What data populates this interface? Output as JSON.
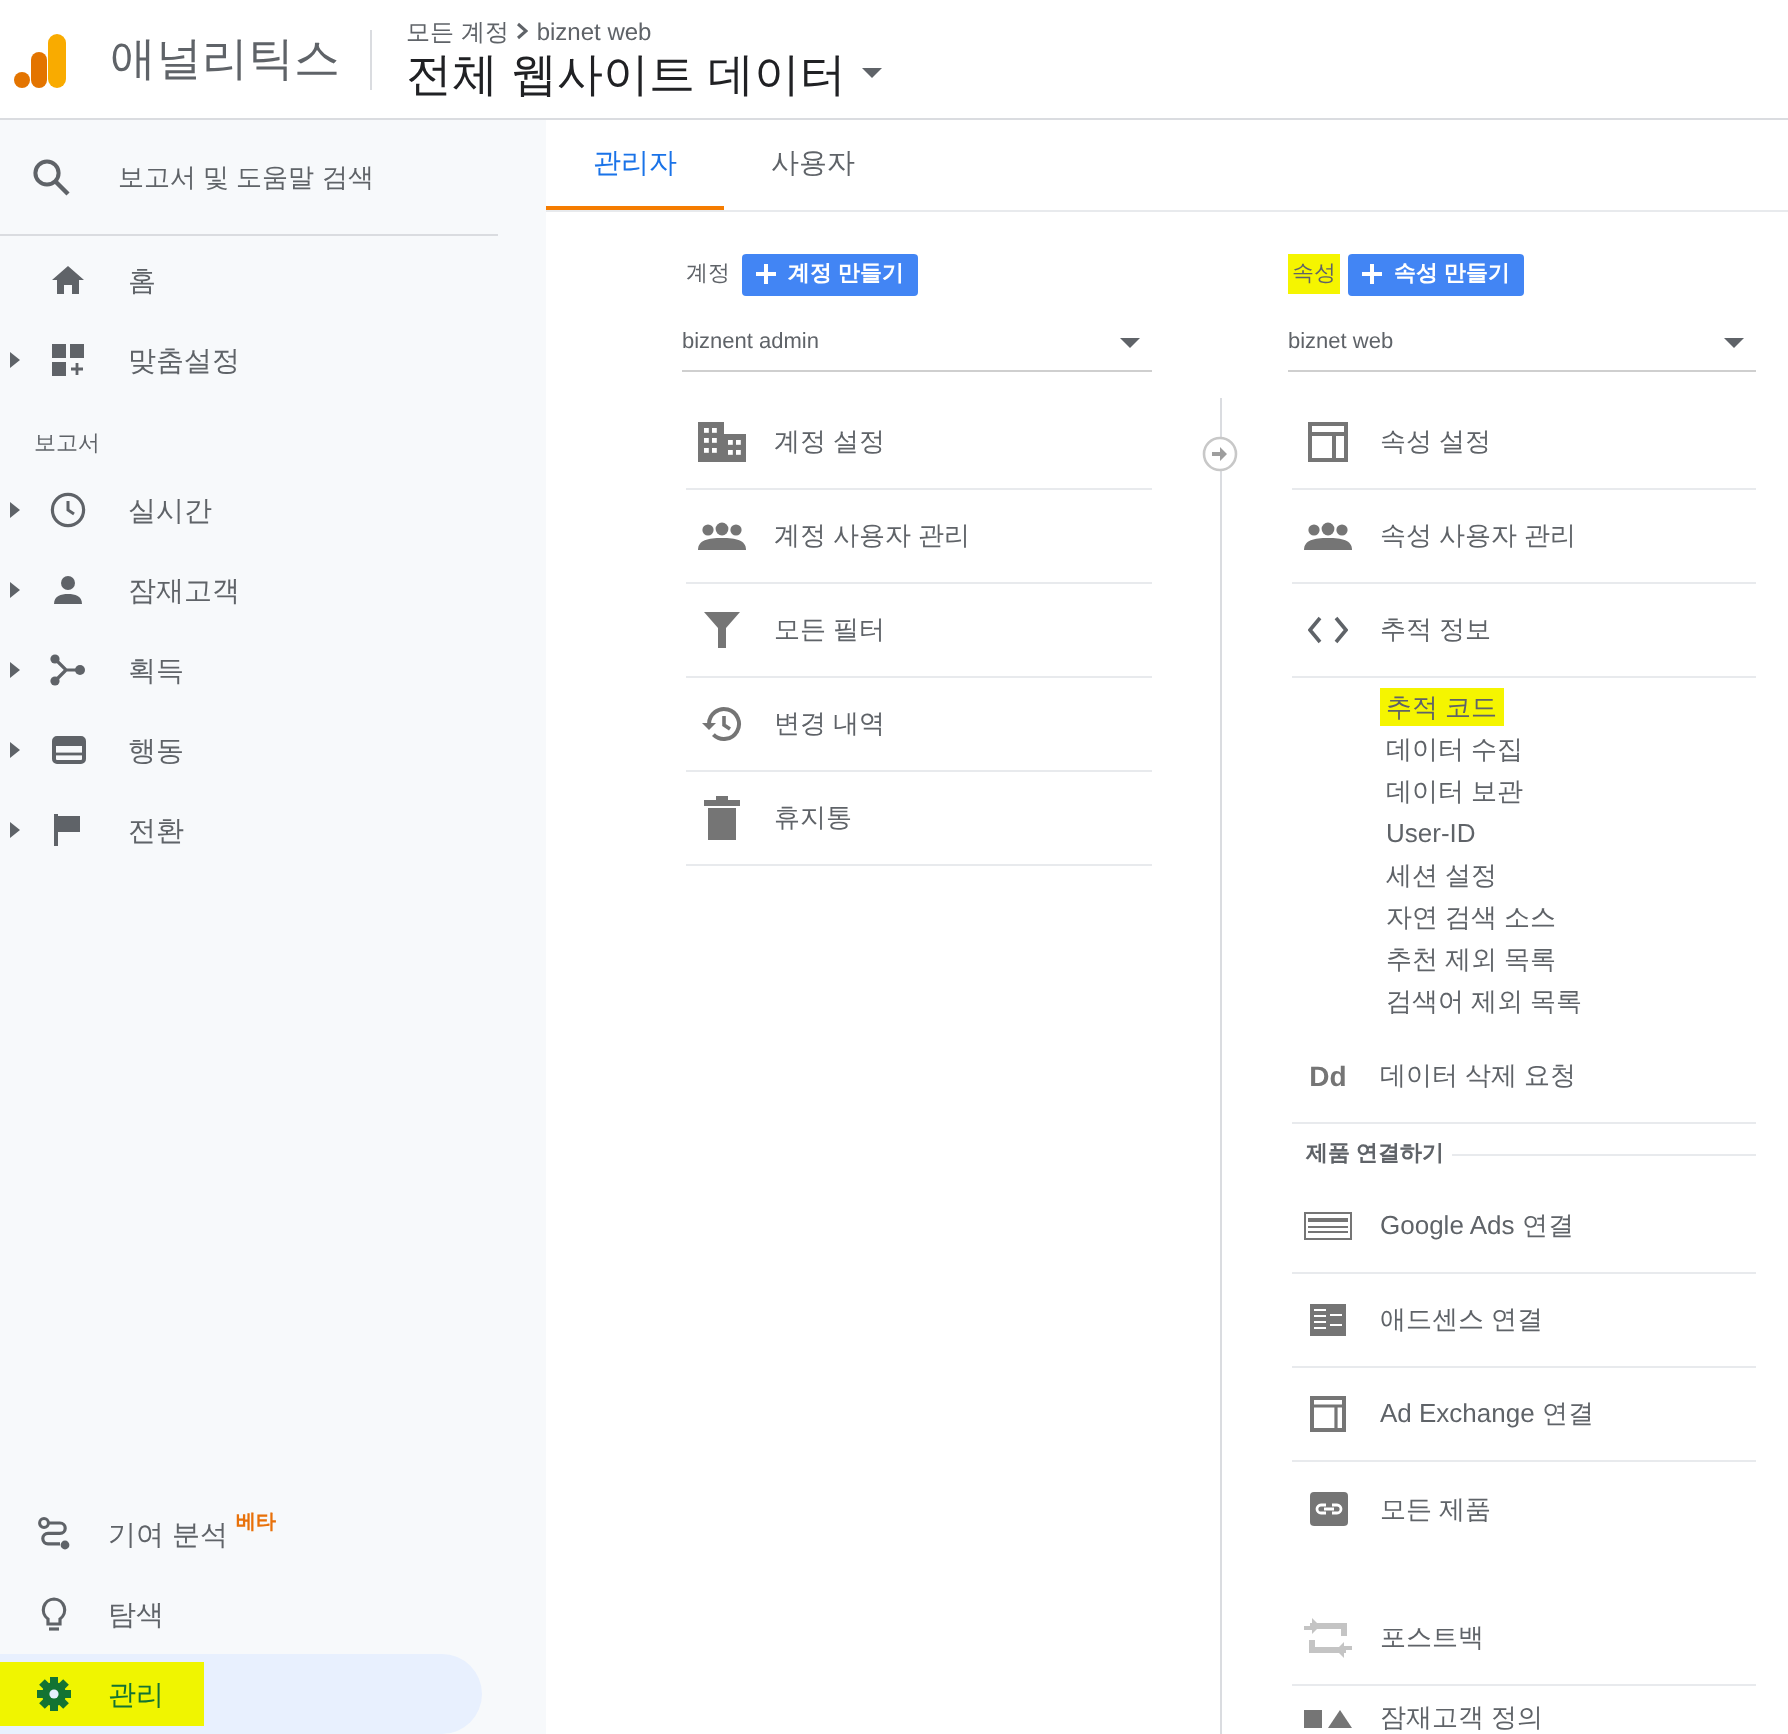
{
  "header": {
    "product": "애널리틱스",
    "breadcrumb": [
      "모든 계정",
      "biznet web"
    ],
    "view": "전체 웹사이트 데이터"
  },
  "sidebar": {
    "search_placeholder": "보고서 및 도움말 검색",
    "top_items": [
      {
        "label": "홈",
        "expandable": false
      },
      {
        "label": "맞춤설정",
        "expandable": true
      }
    ],
    "section_label": "보고서",
    "report_items": [
      {
        "label": "실시간",
        "expandable": true
      },
      {
        "label": "잠재고객",
        "expandable": true
      },
      {
        "label": "획득",
        "expandable": true
      },
      {
        "label": "행동",
        "expandable": true
      },
      {
        "label": "전환",
        "expandable": true
      }
    ],
    "bottom_items": [
      {
        "label": "기여 분석",
        "badge": "베타",
        "selected": false,
        "highlighted": false
      },
      {
        "label": "탐색",
        "selected": false,
        "highlighted": false
      },
      {
        "label": "관리",
        "selected": true,
        "highlighted": true
      }
    ]
  },
  "tabs": [
    {
      "label": "관리자",
      "selected": true
    },
    {
      "label": "사용자",
      "selected": false
    }
  ],
  "account": {
    "label": "계정",
    "label_highlighted": false,
    "create_button": "계정 만들기",
    "selector": "biznent admin",
    "items": [
      {
        "label": "계정 설정"
      },
      {
        "label": "계정 사용자 관리"
      },
      {
        "label": "모든 필터"
      },
      {
        "label": "변경 내역"
      },
      {
        "label": "휴지통"
      }
    ]
  },
  "property": {
    "label": "속성",
    "label_highlighted": true,
    "create_button": "속성 만들기",
    "selector": "biznet web",
    "items": [
      {
        "label": "속성 설정"
      },
      {
        "label": "속성 사용자 관리"
      },
      {
        "label": "추적 정보",
        "children": [
          {
            "label": "추적 코드",
            "highlighted": true
          },
          {
            "label": "데이터 수집",
            "highlighted": false
          },
          {
            "label": "데이터 보관",
            "highlighted": false
          },
          {
            "label": "User-ID",
            "highlighted": false
          },
          {
            "label": "세션 설정",
            "highlighted": false
          },
          {
            "label": "자연 검색 소스",
            "highlighted": false
          },
          {
            "label": "추천 제외 목록",
            "highlighted": false
          },
          {
            "label": "검색어 제외 목록",
            "highlighted": false
          }
        ]
      },
      {
        "label": "데이터 삭제 요청",
        "icon_text": "Dd"
      }
    ],
    "product_links": {
      "title": "제품 연결하기",
      "items": [
        {
          "label": "Google Ads 연결"
        },
        {
          "label": "애드센스 연결"
        },
        {
          "label": "Ad Exchange 연결"
        },
        {
          "label": "모든 제품"
        }
      ]
    },
    "other_items": [
      {
        "label": "포스트백"
      },
      {
        "label": "잠재고객 정의"
      }
    ]
  }
}
